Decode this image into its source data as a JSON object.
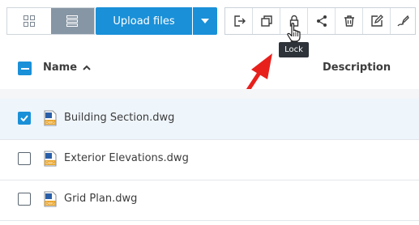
{
  "toolbar": {
    "upload_label": "Upload files",
    "tooltip": "Lock"
  },
  "table": {
    "columns": {
      "name": "Name",
      "description": "Description"
    },
    "rows": [
      {
        "name": "Building Section.dwg",
        "selected": true
      },
      {
        "name": "Exterior Elevations.dwg",
        "selected": false
      },
      {
        "name": "Grid Plan.dwg",
        "selected": false
      }
    ]
  },
  "icons": {
    "grid_view": "grid-view-icon",
    "list_view": "list-view-icon",
    "dropdown": "caret-down-icon",
    "move": "move-icon",
    "copy": "copy-icon",
    "lock": "lock-icon",
    "share": "share-icon",
    "delete": "trash-icon",
    "rename": "edit-icon",
    "markup": "markup-icon",
    "file_type": "DWG"
  },
  "colors": {
    "primary": "#1a90d8",
    "active_view": "#8796a4",
    "annotation_arrow": "#e8201c"
  }
}
